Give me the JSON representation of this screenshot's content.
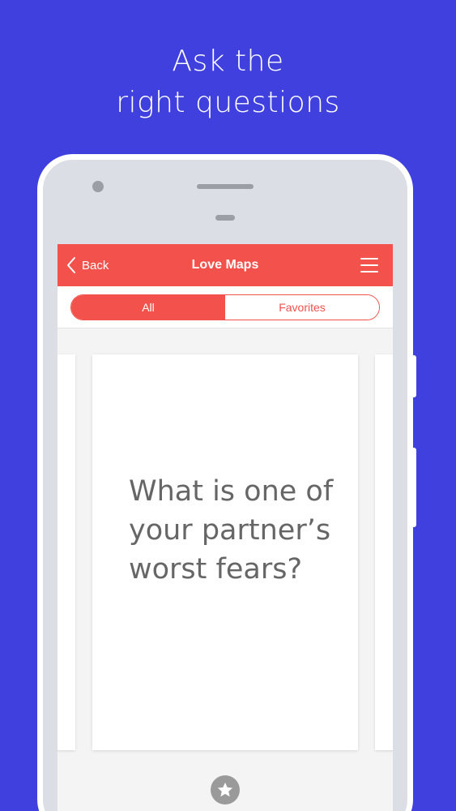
{
  "headline": {
    "line1": "Ask the",
    "line2": "right questions"
  },
  "colors": {
    "background": "#4040df",
    "accent": "#f2524b",
    "card_text": "#666666"
  },
  "appbar": {
    "back_label": "Back",
    "title": "Love Maps",
    "back_icon": "chevron-left-icon",
    "menu_icon": "hamburger-menu-icon"
  },
  "tabs": {
    "all_label": "All",
    "favorites_label": "Favorites",
    "selected": "All"
  },
  "card": {
    "question": "What is one of your partner’s worst fears?"
  },
  "footer": {
    "favorite_icon": "star-icon"
  }
}
